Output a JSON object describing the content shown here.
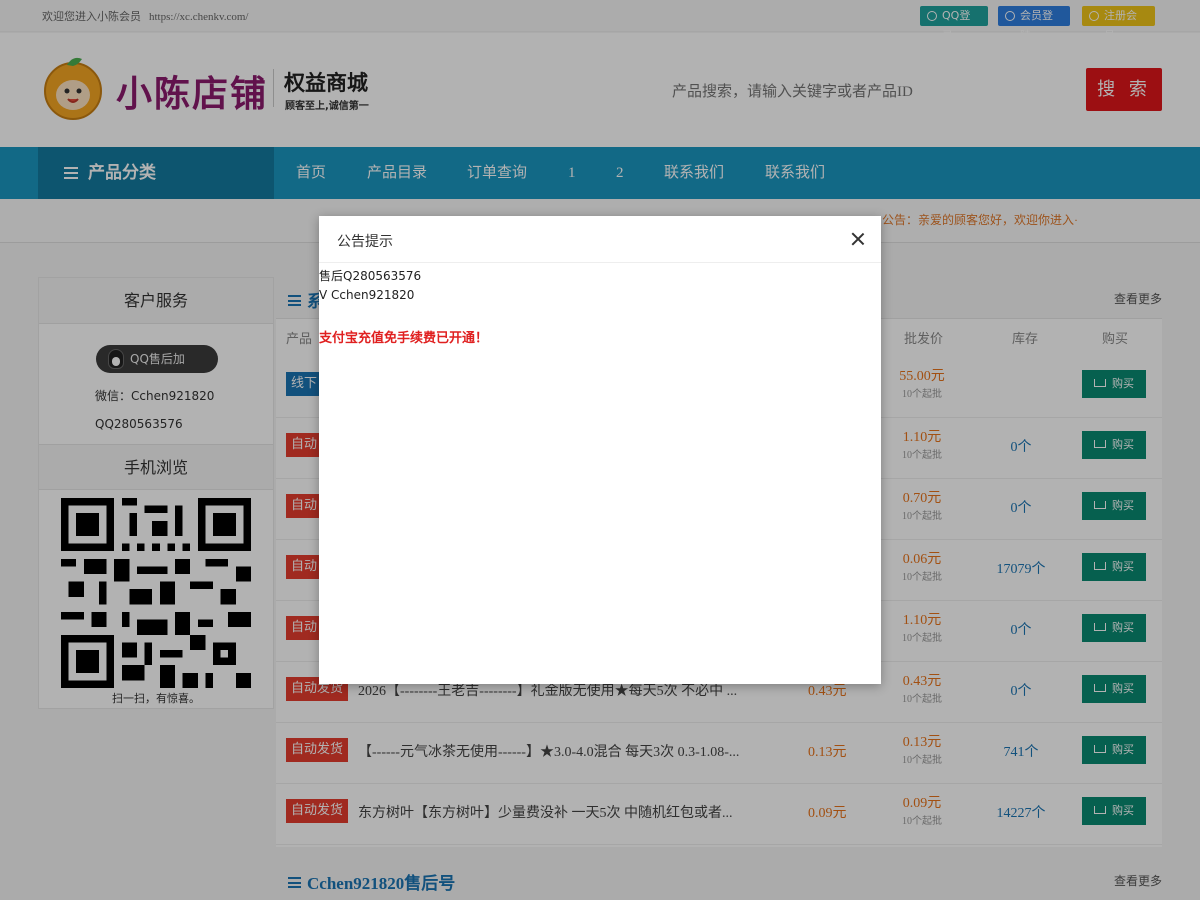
{
  "topbar": {
    "welcome": "欢迎您进入小陈会员",
    "url": "https://xc.chenkv.com/",
    "qq_login": "QQ登录",
    "member_login": "会员登陆",
    "register": "注册会员"
  },
  "header": {
    "logo_text": "小陈店铺",
    "subtitle": "权益商城",
    "slogan": "顾客至上,诚信第一",
    "search_placeholder": "产品搜索，请输入关键字或者产品ID",
    "search_button": "搜 索"
  },
  "nav": {
    "category": "产品分类",
    "items": [
      "首页",
      "产品目录",
      "订单查询",
      "1",
      "2",
      "联系我们",
      "联系我们"
    ]
  },
  "notice": {
    "text": "公告：亲爱的顾客您好，欢迎你进入·"
  },
  "sidebar": {
    "service_title": "客户服务",
    "qq_button": "QQ售后加",
    "wechat": "微信：Cchen921820",
    "qq": "QQ280563576",
    "mobile_title": "手机浏览",
    "qr_caption": "扫一扫，有惊喜。"
  },
  "panel": {
    "title": "系",
    "more": "查看更多",
    "col_product": "产品",
    "col_wholesale": "批发价",
    "col_stock": "库存",
    "col_buy": "购买",
    "buy_label": "购买",
    "rows": [
      {
        "tag": "线下",
        "tag_color": "blue",
        "name": "",
        "price": "",
        "wholesale": "55.00元",
        "min": "10个起批",
        "stock": ""
      },
      {
        "tag": "自动",
        "tag_color": "red",
        "name": "",
        "price": "",
        "wholesale": "1.10元",
        "min": "10个起批",
        "stock": "0个"
      },
      {
        "tag": "自动",
        "tag_color": "red",
        "name": "",
        "price": "",
        "wholesale": "0.70元",
        "min": "10个起批",
        "stock": "0个"
      },
      {
        "tag": "自动",
        "tag_color": "red",
        "name": "",
        "price": "",
        "wholesale": "0.06元",
        "min": "10个起批",
        "stock": "17079个"
      },
      {
        "tag": "自动",
        "tag_color": "red",
        "name": "",
        "price": "",
        "wholesale": "1.10元",
        "min": "10个起批",
        "stock": "0个"
      },
      {
        "tag": "自动发货",
        "tag_color": "red",
        "name": "2026【--------王老吉--------】礼金版无使用★每天5次 不必中 ...",
        "price": "0.43元",
        "wholesale": "0.43元",
        "min": "10个起批",
        "stock": "0个"
      },
      {
        "tag": "自动发货",
        "tag_color": "red",
        "name": "【------元气冰茶无使用------】★3.0-4.0混合 每天3次 0.3-1.08-...",
        "price": "0.13元",
        "wholesale": "0.13元",
        "min": "10个起批",
        "stock": "741个"
      },
      {
        "tag": "自动发货",
        "tag_color": "red",
        "name": "东方树叶【东方树叶】少量费没补 一天5次 中随机红包或者...",
        "price": "0.09元",
        "wholesale": "0.09元",
        "min": "10个起批",
        "stock": "14227个"
      }
    ]
  },
  "panel2": {
    "title": "Cchen921820售后号",
    "more": "查看更多"
  },
  "modal": {
    "title": "公告提示",
    "line1": "售后Q280563576",
    "line2": "V   Cchen921820",
    "highlight": "支付宝充值免手续费已开通！"
  },
  "colors": {
    "nav": "#1a97c1",
    "nav_dark": "#147aa0",
    "search_button": "#e0161b",
    "buy_button": "#0a8a72",
    "price": "#e8731a",
    "highlight": "#e02020"
  }
}
